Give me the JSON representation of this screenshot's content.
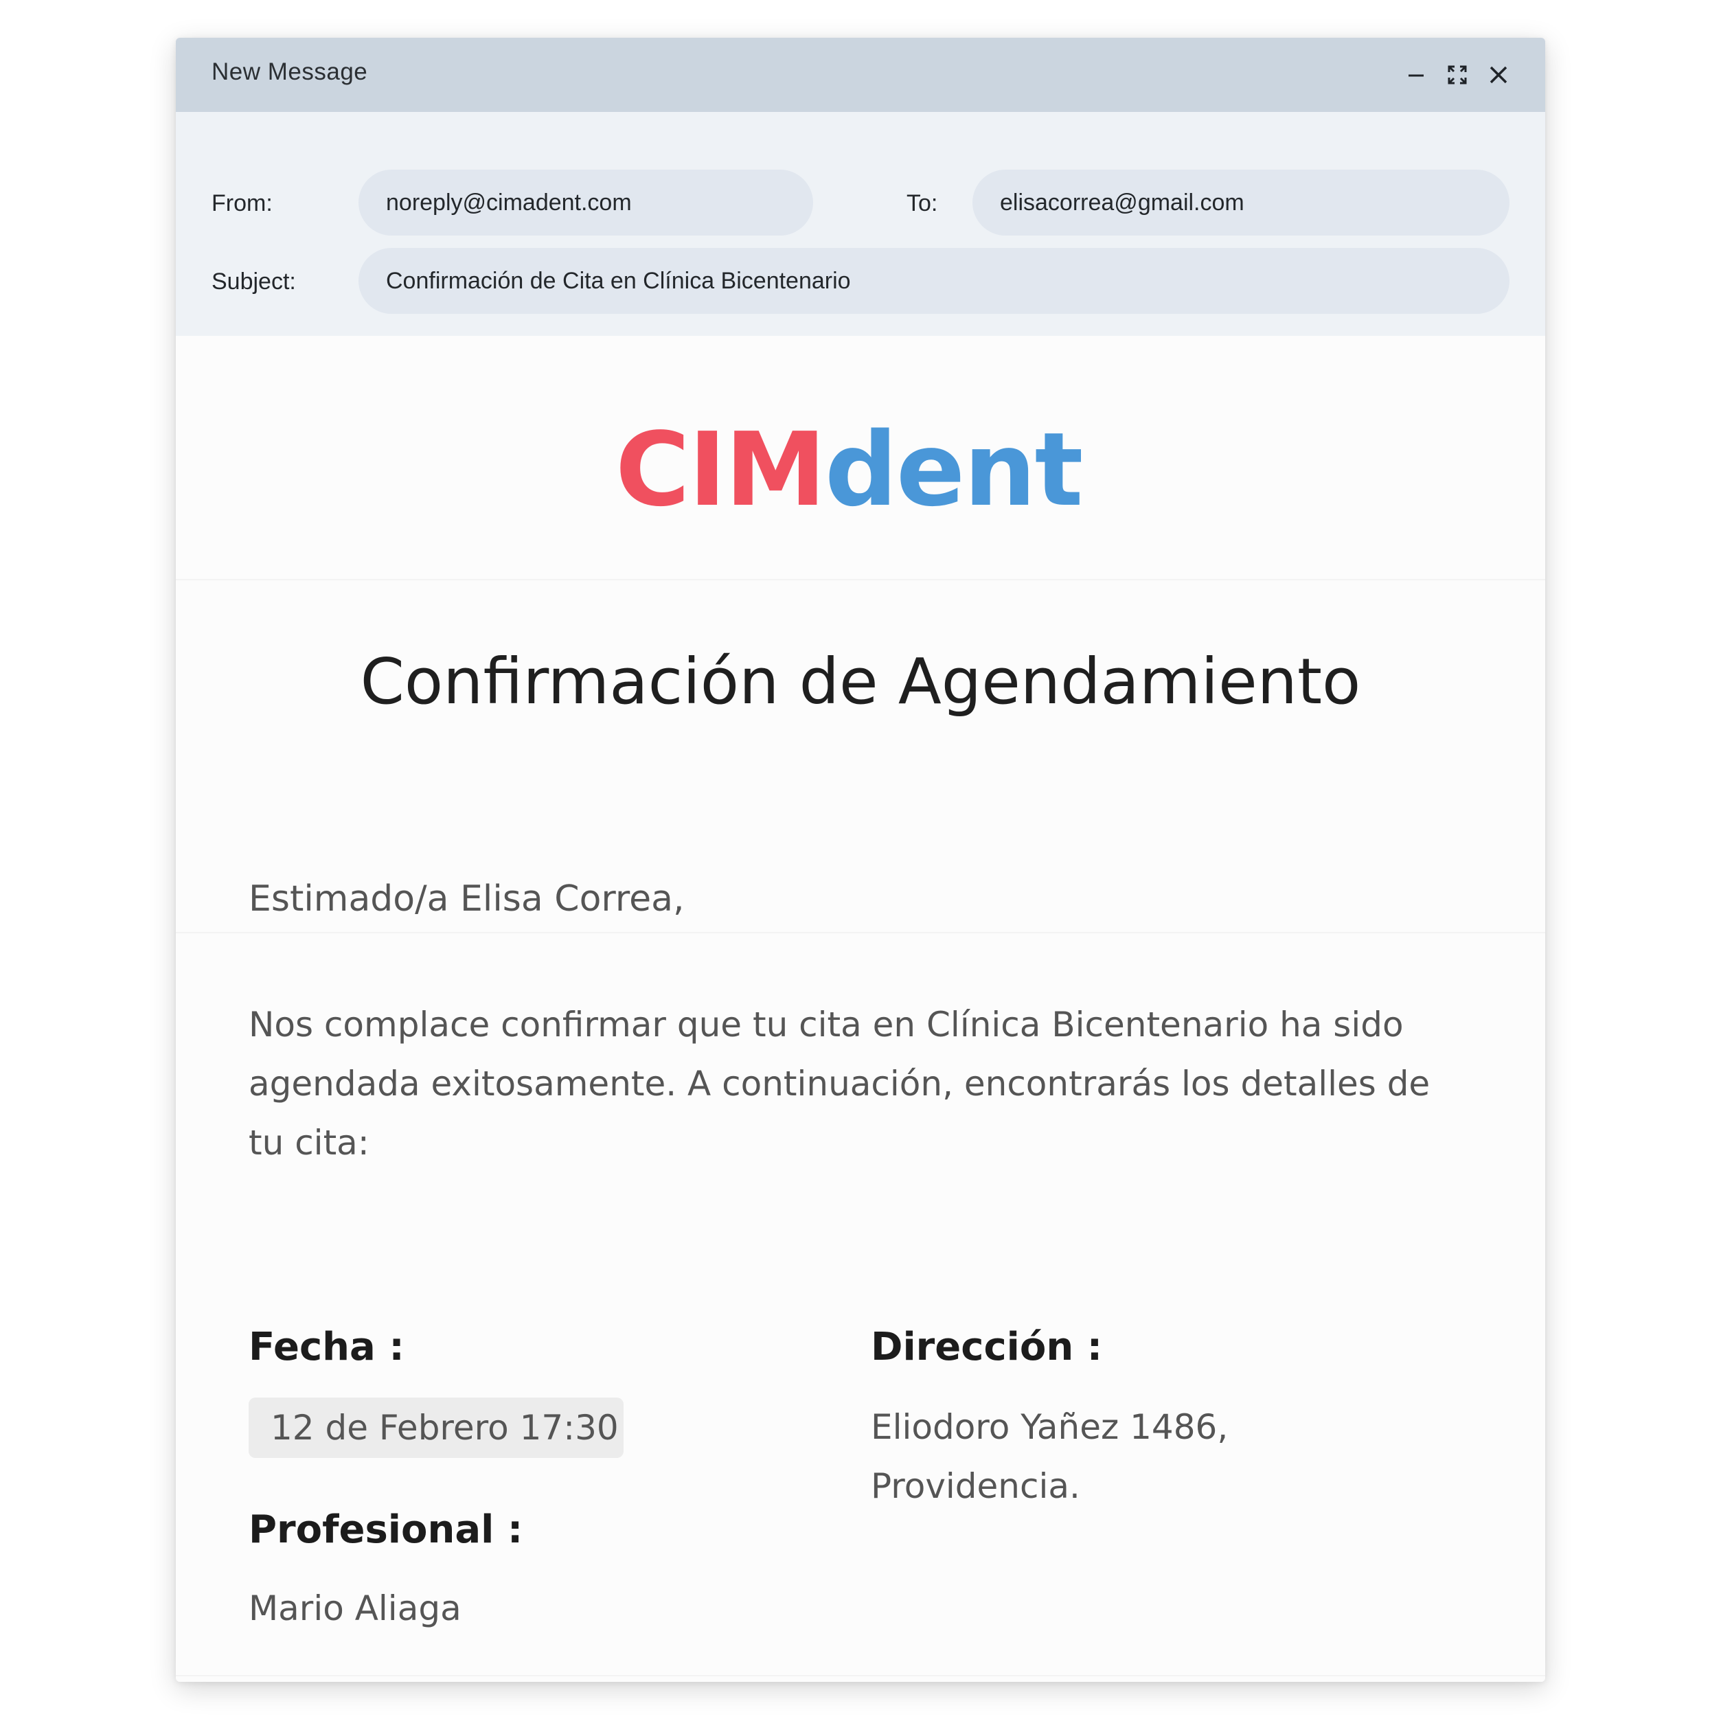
{
  "window": {
    "title": "New Message"
  },
  "controls": {
    "minimize": "minimize-icon",
    "expand": "expand-icon",
    "close": "close-icon"
  },
  "compose": {
    "from_label": "From:",
    "from_value": "noreply@cimadent.com",
    "to_label": "To:",
    "to_value": "elisacorrea@gmail.com",
    "subject_label": "Subject:",
    "subject_value": "Confirmación de Cita en Clínica Bicentenario"
  },
  "email": {
    "logo_red": "CIM",
    "logo_blue": "dent",
    "brand_colors": {
      "red": "#f0505f",
      "blue": "#4a97d8"
    },
    "heading": "Confirmación de Agendamiento",
    "greeting": "Estimado/a Elisa Correa,",
    "paragraph": "Nos complace confirmar que tu cita en Clínica Bicentenario ha sido agendada exitosamente. A continuación, encontrarás los detalles de tu cita:",
    "fecha_label": "Fecha :",
    "fecha_value": "12 de Febrero 17:30",
    "profesional_label": "Profesional :",
    "profesional_value": "Mario Aliaga",
    "direccion_label": "Dirección :",
    "direccion_line1": "Eliodoro Yañez 1486,",
    "direccion_line2": "Providencia."
  }
}
